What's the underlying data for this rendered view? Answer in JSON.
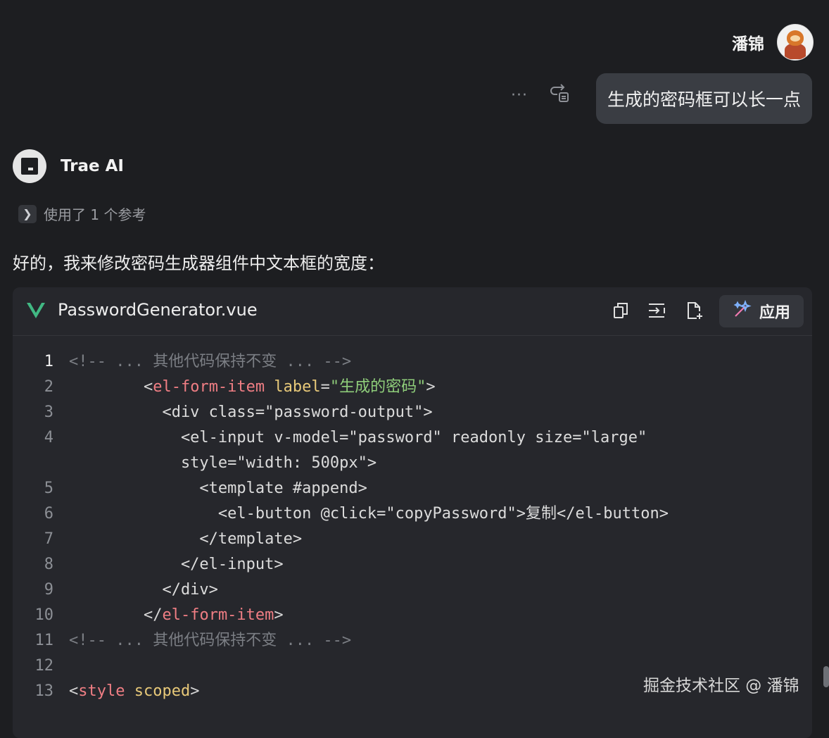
{
  "user": {
    "name": "潘锦",
    "message": "生成的密码框可以长一点"
  },
  "message_actions": {
    "more": "···"
  },
  "ai": {
    "name": "Trae AI",
    "references": "使用了 1 个参考",
    "intro": "好的，我来修改密码生成器组件中文本框的宽度："
  },
  "code_block": {
    "filename": "PasswordGenerator.vue",
    "apply_label": "应用",
    "lines": [
      {
        "num": "1",
        "active": true,
        "segments": [
          {
            "t": "<!-- ... 其他代码保持不变 ... -->",
            "c": "comment"
          }
        ]
      },
      {
        "num": "2",
        "segments": [
          {
            "t": "        ",
            "c": "plain"
          },
          {
            "t": "<",
            "c": "punct"
          },
          {
            "t": "el-form-item",
            "c": "tag"
          },
          {
            "t": " ",
            "c": "plain"
          },
          {
            "t": "label",
            "c": "attr"
          },
          {
            "t": "=",
            "c": "punct"
          },
          {
            "t": "\"生成的密码\"",
            "c": "str"
          },
          {
            "t": ">",
            "c": "punct"
          }
        ]
      },
      {
        "num": "3",
        "segments": [
          {
            "t": "          <div class=\"password-output\">",
            "c": "plain"
          }
        ]
      },
      {
        "num": "4",
        "segments": [
          {
            "t": "            <el-input v-model=\"password\" readonly size=\"large\"",
            "c": "plain"
          }
        ]
      },
      {
        "num": "",
        "segments": [
          {
            "t": "            style=\"width: 500px\">",
            "c": "plain"
          }
        ]
      },
      {
        "num": "5",
        "segments": [
          {
            "t": "              <template #append>",
            "c": "plain"
          }
        ]
      },
      {
        "num": "6",
        "segments": [
          {
            "t": "                <el-button @click=\"copyPassword\">复制</el-button>",
            "c": "plain"
          }
        ]
      },
      {
        "num": "7",
        "segments": [
          {
            "t": "              </template>",
            "c": "plain"
          }
        ]
      },
      {
        "num": "8",
        "segments": [
          {
            "t": "            </el-input>",
            "c": "plain"
          }
        ]
      },
      {
        "num": "9",
        "segments": [
          {
            "t": "          </div>",
            "c": "plain"
          }
        ]
      },
      {
        "num": "10",
        "segments": [
          {
            "t": "        ",
            "c": "plain"
          },
          {
            "t": "</",
            "c": "punct"
          },
          {
            "t": "el-form-item",
            "c": "tag"
          },
          {
            "t": ">",
            "c": "punct"
          }
        ]
      },
      {
        "num": "11",
        "segments": [
          {
            "t": "<!-- ... 其他代码保持不变 ... -->",
            "c": "comment"
          }
        ]
      },
      {
        "num": "12",
        "segments": [
          {
            "t": "",
            "c": "plain"
          }
        ]
      },
      {
        "num": "13",
        "segments": [
          {
            "t": "<",
            "c": "punct"
          },
          {
            "t": "style",
            "c": "tag"
          },
          {
            "t": " ",
            "c": "plain"
          },
          {
            "t": "scoped",
            "c": "attr"
          },
          {
            "t": ">",
            "c": "punct"
          }
        ]
      }
    ]
  },
  "watermark": "掘金技术社区 @ 潘锦",
  "colors": {
    "background": "#1d1e21",
    "card": "#26272c",
    "bubble": "#3a3d43",
    "tag": "#f07e84",
    "attr": "#e8c979",
    "string": "#8fce7a",
    "comment": "#7b7e84",
    "vue_green": "#41b883"
  }
}
